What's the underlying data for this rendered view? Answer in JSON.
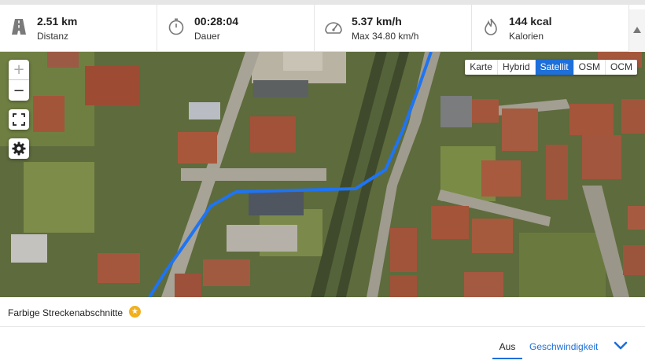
{
  "stats": [
    {
      "icon": "road-icon",
      "value": "2.51 km",
      "label": "Distanz"
    },
    {
      "icon": "stopwatch-icon",
      "value": "00:28:04",
      "label": "Dauer"
    },
    {
      "icon": "speedometer-icon",
      "value": "5.37 km/h",
      "label": "Max 34.80 km/h"
    },
    {
      "icon": "flame-icon",
      "value": "144 kcal",
      "label": "Kalorien"
    }
  ],
  "map": {
    "zoom_in": "+",
    "zoom_out": "−",
    "layers": [
      "Karte",
      "Hybrid",
      "Satellit",
      "OSM",
      "OCM"
    ],
    "active_layer": "Satellit",
    "route_color": "#1f74f2"
  },
  "section": {
    "title": "Farbige Streckenabschnitte",
    "badge": "★"
  },
  "tabs": {
    "off": "Aus",
    "speed": "Geschwindigkeit",
    "active": "Aus"
  },
  "colors": {
    "accent": "#1e6fd9",
    "badge": "#f2b01e"
  }
}
